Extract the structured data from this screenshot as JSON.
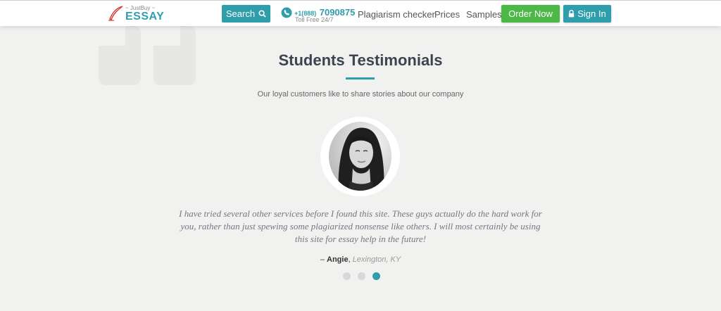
{
  "header": {
    "logo": {
      "tagline": "~ JustBuy ~",
      "brand": "ESSAY"
    },
    "search_label": "Search",
    "phone": {
      "prefix": "+1(888)",
      "number": "7090875",
      "note": "Toll Free 24/7"
    },
    "nav": {
      "plagiarism": "Plagiarism checker",
      "prices": "Prices",
      "samples": "Samples"
    },
    "order_label": "Order Now",
    "signin_label": "Sign In"
  },
  "section": {
    "title": "Students Testimonials",
    "subtitle": "Our loyal customers like to share stories about our company"
  },
  "testimonial": {
    "text": "I have tried several other services before I found this site. These guys actually do the hard work for you, rather than just spewing some plagiarized nonsense like others. I will most certainly be using this site for essay help in the future!",
    "dash": "– ",
    "author": "Angie",
    "separator": ", ",
    "location": "Lexington, KY"
  },
  "carousel": {
    "count": 3,
    "active_index": 2
  },
  "colors": {
    "accent": "#2f9eab",
    "order": "#4cb848",
    "background": "#f1f1f0"
  },
  "icons": [
    "quill-icon",
    "search-icon",
    "phone-icon",
    "lock-icon",
    "quote-icon"
  ]
}
